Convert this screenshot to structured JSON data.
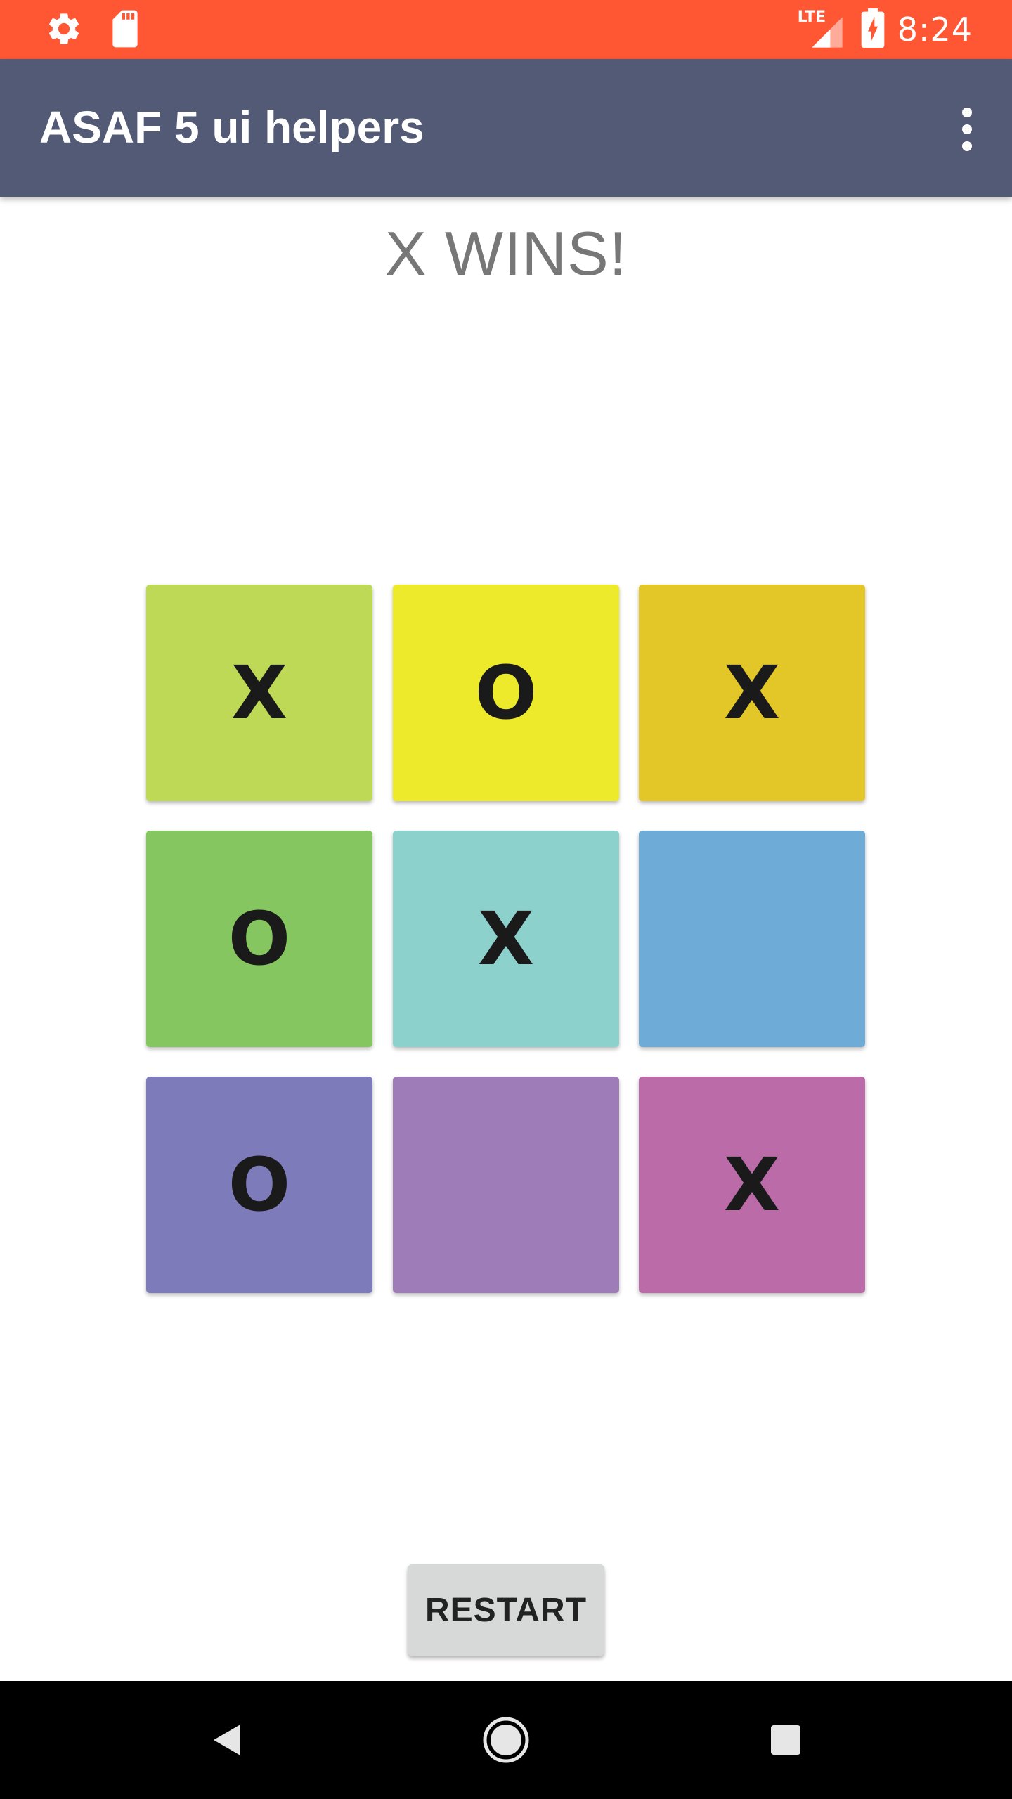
{
  "status_bar": {
    "time": "8:24",
    "network_label": "LTE",
    "icons": [
      "settings-icon",
      "sd-card-icon",
      "signal-icon",
      "battery-charging-icon"
    ],
    "background_color": "#ff5733"
  },
  "app_bar": {
    "title": "ASAF 5 ui helpers",
    "menu_icon": "more-vert-icon",
    "background_color": "#525a75"
  },
  "game": {
    "status": "X WINS!",
    "board": [
      {
        "mark": "X",
        "color": "#bdd955"
      },
      {
        "mark": "O",
        "color": "#ecea2a"
      },
      {
        "mark": "X",
        "color": "#e3c628"
      },
      {
        "mark": "O",
        "color": "#85c660"
      },
      {
        "mark": "X",
        "color": "#8dd1cc"
      },
      {
        "mark": "",
        "color": "#6eabd6"
      },
      {
        "mark": "O",
        "color": "#7e7bbb"
      },
      {
        "mark": "",
        "color": "#9e7cb8"
      },
      {
        "mark": "X",
        "color": "#ba6ba8"
      }
    ]
  },
  "actions": {
    "restart_label": "RESTART"
  },
  "nav_bar": {
    "icons": [
      "back-icon",
      "home-icon",
      "recents-icon"
    ]
  }
}
